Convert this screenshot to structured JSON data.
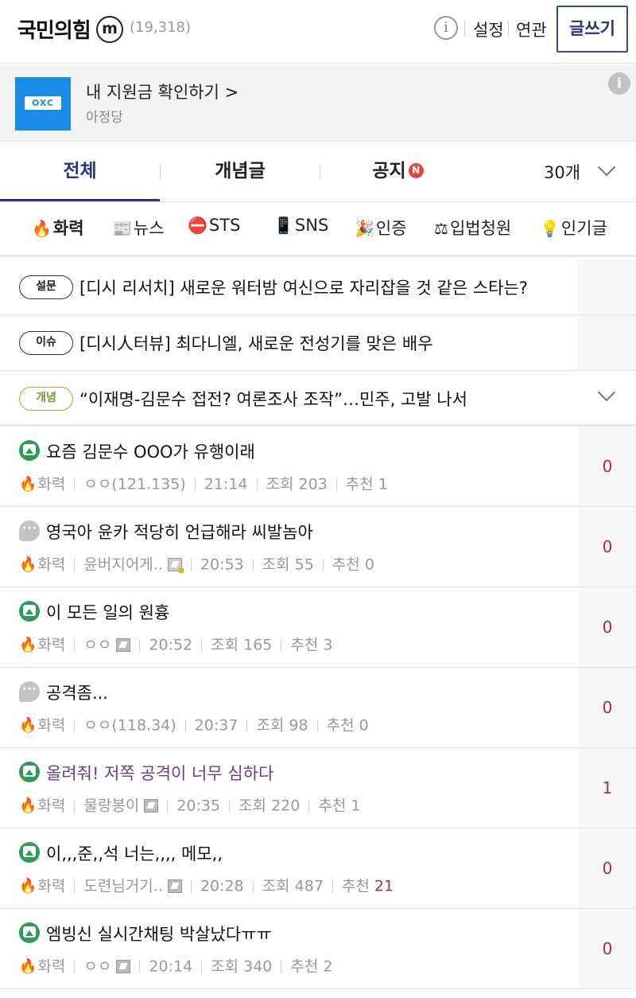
{
  "header": {
    "gallery_name": "국민의힘",
    "badge": "m",
    "member_count": "(19,318)",
    "links": [
      "설정",
      "연관"
    ],
    "write_button": "글쓰기"
  },
  "ad": {
    "logo_text": "OXC",
    "title": "내 지원금 확인하기 >",
    "subtitle": "아정당"
  },
  "tabs": {
    "items": [
      "전체",
      "개념글",
      "공지"
    ],
    "notice_badge": "N",
    "count": "30개"
  },
  "categories": [
    {
      "icon": "🔥",
      "label": "화력"
    },
    {
      "icon": "📰",
      "label": "뉴스"
    },
    {
      "icon": "⛔",
      "label": "STS"
    },
    {
      "icon": "📱",
      "label": "SNS"
    },
    {
      "icon": "🎉",
      "label": "인증"
    },
    {
      "icon": "⚖",
      "label": "입법청원"
    },
    {
      "icon": "💡",
      "label": "인기글"
    }
  ],
  "notices": [
    {
      "tag": "설문",
      "text": "[디시 리서치] 새로운 워터밤 여신으로 자리잡을 것 같은 스타는?"
    },
    {
      "tag": "이슈",
      "text": "[디시人터뷰] 최다니엘, 새로운 전성기를 맞은 배우"
    },
    {
      "tag": "개념",
      "text": "“이재명-김문수 접전? 여론조사 조작”…민주, 고발 나서"
    }
  ],
  "posts": [
    {
      "title": "요즘 김문수 OOO가 유행이래",
      "category": "화력",
      "author": "ㅇㅇ(121.135)",
      "time": "21:14",
      "views": "조회 203",
      "reco_label": "추천",
      "reco": "1",
      "comments": "0"
    },
    {
      "title": "영국아 윤카 적당히 언급해라 씨발놈아",
      "category": "화력",
      "author": "윤버지어게..",
      "time": "20:53",
      "views": "조회 55",
      "reco_label": "추천",
      "reco": "0",
      "comments": "0"
    },
    {
      "title": "이 모든 일의 원흉",
      "category": "화력",
      "author": "ㅇㅇ",
      "time": "20:52",
      "views": "조회 165",
      "reco_label": "추천",
      "reco": "3",
      "comments": "0"
    },
    {
      "title": "공격좀...",
      "category": "화력",
      "author": "ㅇㅇ(118.34)",
      "time": "20:37",
      "views": "조회 98",
      "reco_label": "추천",
      "reco": "0",
      "comments": "0"
    },
    {
      "title": "올려줘! 저쪽 공격이 너무 심하다",
      "category": "화력",
      "author": "물랑봉이",
      "time": "20:35",
      "views": "조회 220",
      "reco_label": "추천",
      "reco": "1",
      "comments": "1"
    },
    {
      "title": "이,,,준,,석 너는,,,, 메모,,",
      "category": "화력",
      "author": "도련님거기..",
      "time": "20:28",
      "views": "조회 487",
      "reco_label": "추천",
      "reco": "21",
      "comments": "0"
    },
    {
      "title": "엠빙신 실시간채팅 박살났다ㅠㅠ",
      "category": "화력",
      "author": "ㅇㅇ",
      "time": "20:14",
      "views": "조회 340",
      "reco_label": "추천",
      "reco": "2",
      "comments": "0"
    }
  ]
}
